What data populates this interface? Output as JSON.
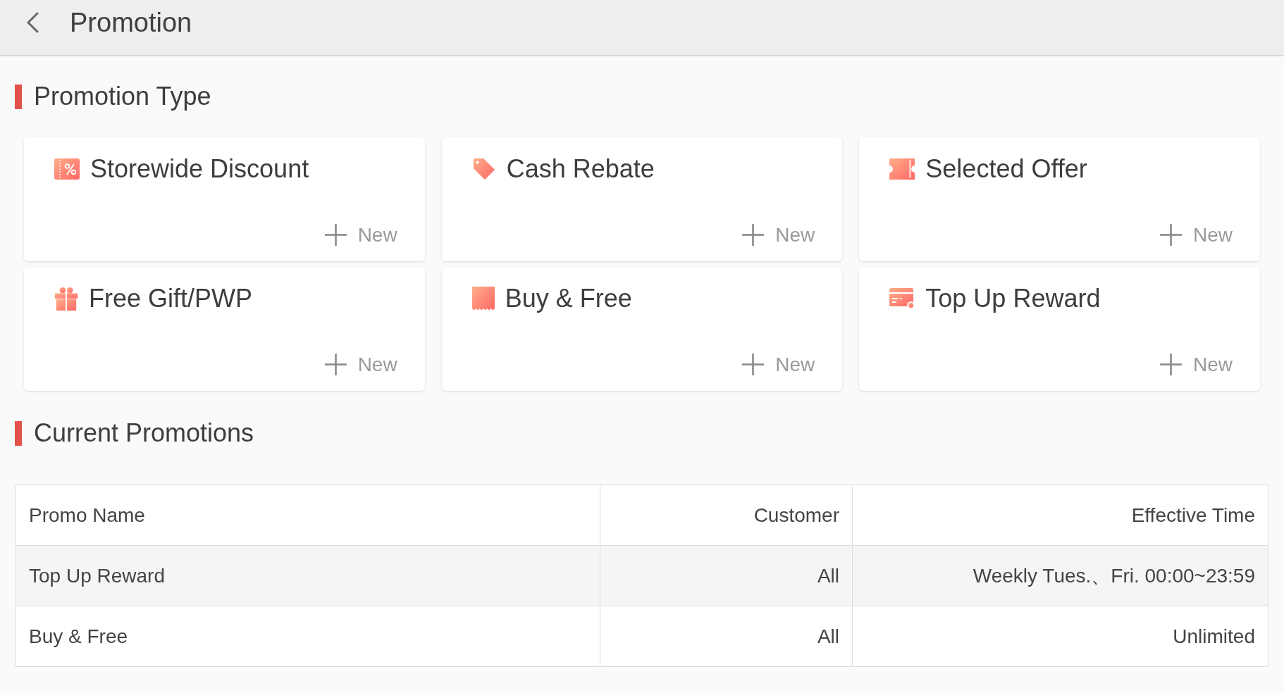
{
  "top_bar": {
    "title": "Promotion"
  },
  "promotion_types": {
    "heading": "Promotion Type",
    "cards": [
      {
        "kind": "discount",
        "title": "Storewide Discount",
        "action": "New"
      },
      {
        "kind": "rebate",
        "title": "Cash Rebate",
        "action": "New"
      },
      {
        "kind": "offer",
        "title": "Selected Offer",
        "action": "New"
      },
      {
        "kind": "gift",
        "title": "Free Gift/PWP",
        "action": "New"
      },
      {
        "kind": "bundle",
        "title": "Buy & Free",
        "action": "New"
      },
      {
        "kind": "topup",
        "title": "Top Up Reward",
        "action": "New"
      }
    ]
  },
  "current_promotions": {
    "heading": "Current Promotions",
    "table": {
      "columns": [
        "Promo Name",
        "Customer",
        "Effective Time"
      ],
      "rows": [
        [
          "Top Up Reward",
          "All",
          "Weekly Tues.、Fri. 00:00~23:59"
        ],
        [
          "Buy & Free",
          "All",
          "Unlimited"
        ]
      ]
    }
  }
}
